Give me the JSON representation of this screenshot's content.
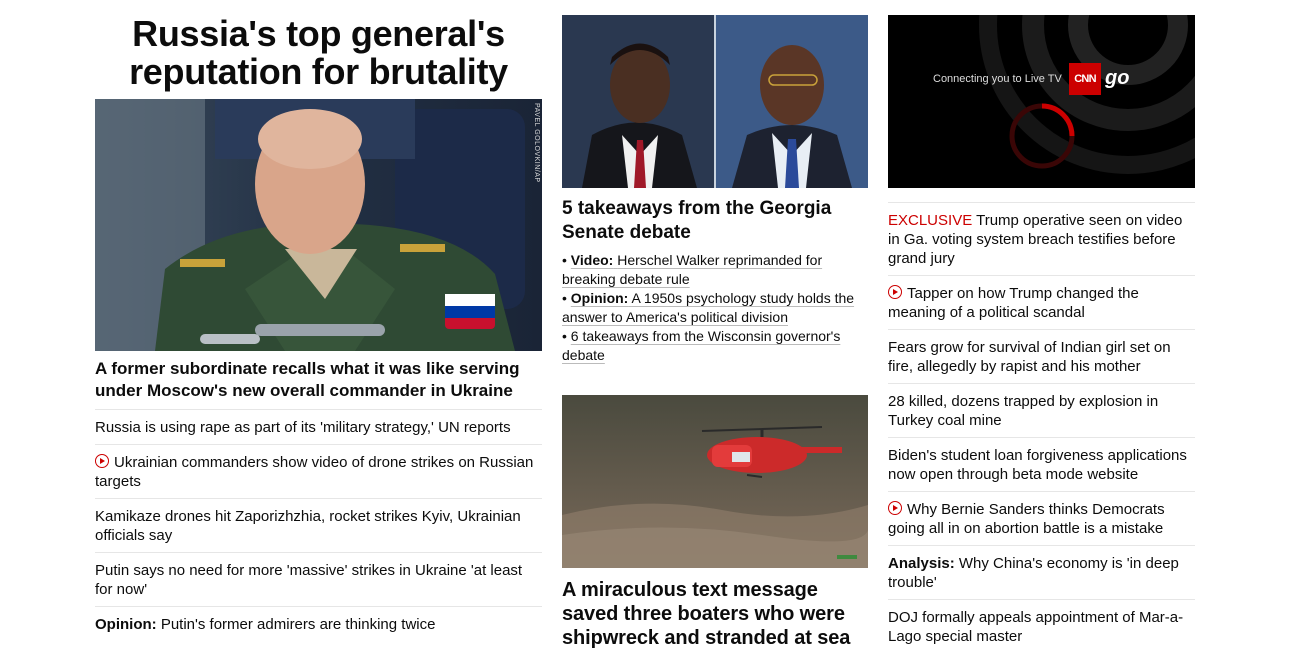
{
  "col1": {
    "hero_title": "Russia's top general's reputation for brutality",
    "photo_credit": "PAVEL GOLOVKIN/AP",
    "lead_headline": "A former subordinate recalls what it was like serving under Moscow's new overall commander in Ukraine",
    "stories": [
      {
        "prefix": "",
        "text": "Russia is using rape as part of its 'military strategy,' UN reports",
        "video": false
      },
      {
        "prefix": "",
        "text": "Ukrainian commanders show video of drone strikes on Russian targets",
        "video": true
      },
      {
        "prefix": "",
        "text": "Kamikaze drones hit Zaporizhzhia, rocket strikes Kyiv, Ukrainian officials say",
        "video": false
      },
      {
        "prefix": "",
        "text": "Putin says no need for more 'massive' strikes in Ukraine 'at least for now'",
        "video": false
      },
      {
        "prefix": "Opinion:",
        "text": "Putin's former admirers are thinking twice",
        "video": false
      }
    ]
  },
  "col2": {
    "headline1": "5 takeaways from the Georgia Senate debate",
    "bullets": [
      {
        "prefix": "Video:",
        "text": "Herschel Walker reprimanded for breaking debate rule"
      },
      {
        "prefix": "Opinion:",
        "text": "A 1950s psychology study holds the answer to America's political division"
      },
      {
        "prefix": "",
        "text": "6 takeaways from the Wisconsin governor's debate"
      }
    ],
    "headline2": "A miraculous text message saved three boaters who were shipwreck and stranded at sea"
  },
  "col3": {
    "player": {
      "connecting_text": "Connecting you to Live TV",
      "logo_text": "CNN",
      "go_text": "go"
    },
    "stories": [
      {
        "prefix": "",
        "tag": "EXCLUSIVE",
        "text": "Trump operative seen on video in Ga. voting system breach testifies before grand jury",
        "video": false
      },
      {
        "prefix": "",
        "tag": "",
        "text": "Tapper on how Trump changed the meaning of a political scandal",
        "video": true
      },
      {
        "prefix": "",
        "tag": "",
        "text": "Fears grow for survival of Indian girl set on fire, allegedly by rapist and his mother",
        "video": false
      },
      {
        "prefix": "",
        "tag": "",
        "text": "28 killed, dozens trapped by explosion in Turkey coal mine",
        "video": false
      },
      {
        "prefix": "",
        "tag": "",
        "text": "Biden's student loan forgiveness applications now open through beta mode website",
        "video": false
      },
      {
        "prefix": "",
        "tag": "",
        "text": "Why Bernie Sanders thinks Democrats going all in on abortion battle is a mistake",
        "video": true
      },
      {
        "prefix": "Analysis:",
        "tag": "",
        "text": "Why China's economy is 'in deep trouble'",
        "video": false
      },
      {
        "prefix": "",
        "tag": "",
        "text": "DOJ formally appeals appointment of Mar-a-Lago special master",
        "video": false
      }
    ]
  },
  "colors": {
    "accent": "#cc0000",
    "text": "#0c0c0c",
    "divider": "#e6e6e6"
  }
}
